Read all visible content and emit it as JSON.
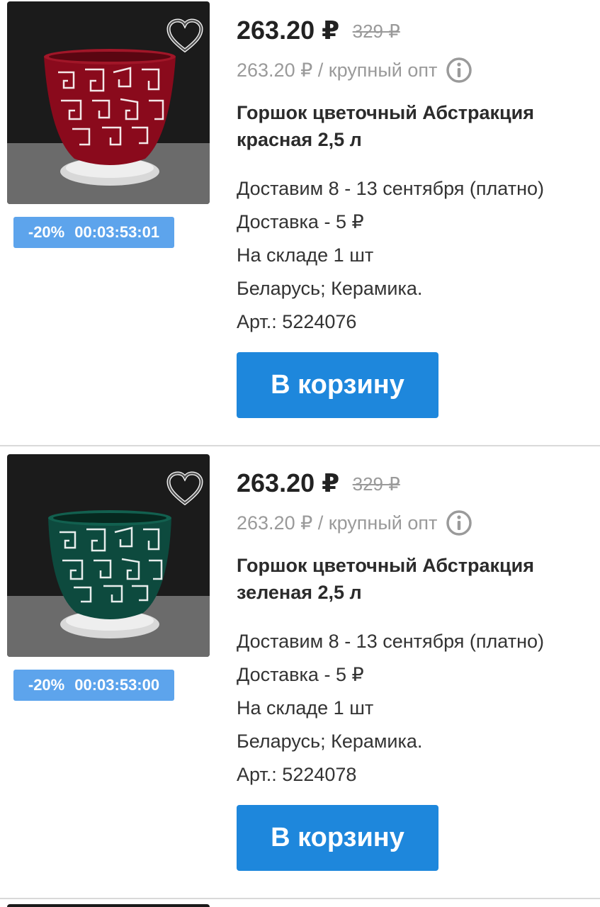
{
  "products": [
    {
      "image": {
        "pot_color": "#8a0a1c",
        "background": "#1b1b1b",
        "surface": "#6e6e6e"
      },
      "favorite_icon": "heart-outline-icon",
      "discount": "-20%",
      "timer": "00:03:53:01",
      "price": "263.20 ₽",
      "old_price": "329 ₽",
      "wholesale": "263.20 ₽ / крупный опт",
      "title": "Горшок цветочный Абстракция красная 2,5 л",
      "delivery": "Доставим 8 - 13 сентября (платно)",
      "shipping": "Доставка - 5 ₽",
      "stock": "На складе 1 шт",
      "origin": "Беларусь; Керамика.",
      "sku": "Арт.: 5224076",
      "cart_label": "В корзину"
    },
    {
      "image": {
        "pot_color": "#0d4a3e",
        "background": "#1b1b1b",
        "surface": "#6e6e6e"
      },
      "favorite_icon": "heart-outline-icon",
      "discount": "-20%",
      "timer": "00:03:53:00",
      "price": "263.20 ₽",
      "old_price": "329 ₽",
      "wholesale": "263.20 ₽ / крупный опт",
      "title": "Горшок цветочный Абстракция зеленая 2,5 л",
      "delivery": "Доставим 8 - 13 сентября (платно)",
      "shipping": "Доставка - 5 ₽",
      "stock": "На складе 1 шт",
      "origin": "Беларусь; Керамика.",
      "sku": "Арт.: 5224078",
      "cart_label": "В корзину"
    }
  ],
  "colors": {
    "button": "#1e87dc",
    "promo": "#5da4ec",
    "muted": "#9a9a9a"
  }
}
